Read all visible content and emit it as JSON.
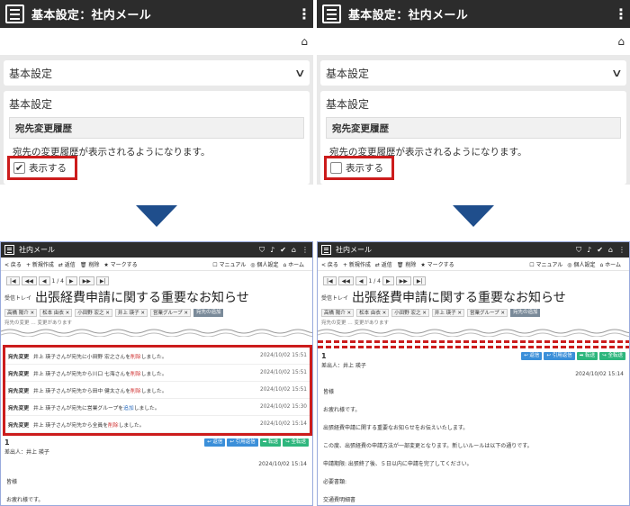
{
  "top": {
    "title": "基本設定：社内メール",
    "accordion_label": "基本設定",
    "panel_title": "基本設定",
    "section_head": "宛先変更履歴",
    "description": "宛先の変更履歴が表示されるようになります。",
    "checkbox_label": "表示する",
    "left_checked": true,
    "right_checked": false
  },
  "arrow_color": "#1f4e8c",
  "highlight_color": "#cc1c1c",
  "mail": {
    "app_title": "社内メール",
    "sub_left": [
      "< 戻る",
      "+ 新規作成",
      "⇄ 返信",
      "🗑 削除",
      "★ マークする"
    ],
    "sub_right": [
      "☐ マニュアル",
      "◎ 個人設定",
      "⌂ ホーム"
    ],
    "pager": "1 / 4",
    "tray": "受信トレイ",
    "subject": "出張経費申請に関する重要なお知らせ",
    "recipients": [
      "高橋 陽介 ✕",
      "松本 由衣 ✕",
      "小田野 宏之 ✕",
      "井上 瑛子 ✕",
      "営業グループ ✕"
    ],
    "history_tag": "宛先の追加",
    "faded_text": "宛先の変更 … 変更があります"
  },
  "history": [
    {
      "kind": "宛先変更",
      "pre": "井上 瑛子さんが宛先に小田野 宏之さんを",
      "act": "削除",
      "post": "しました。",
      "date": "2024/10/02 15:51"
    },
    {
      "kind": "宛先変更",
      "pre": "井上 瑛子さんが宛先から川口 七海さんを",
      "act": "削除",
      "post": "しました。",
      "date": "2024/10/02 15:51"
    },
    {
      "kind": "宛先変更",
      "pre": "井上 瑛子さんが宛先から田中 健太さんを",
      "act": "削除",
      "post": "しました。",
      "date": "2024/10/02 15:51"
    },
    {
      "kind": "宛先変更",
      "pre": "井上 瑛子さんが宛先に営業グループを",
      "act": "追加",
      "post": "しました。",
      "date": "2024/10/02 15:30"
    },
    {
      "kind": "宛先変更",
      "pre": "井上 瑛子さんが宛先から全員を",
      "act": "削除",
      "post": "しました。",
      "date": "2024/10/02 15:14"
    }
  ],
  "message": {
    "number": "1",
    "sender": "差出人：井上 瑛子",
    "buttons": [
      "↩ 返信",
      "↩ 引用返信",
      "➡ 転送",
      "↪ 全転送"
    ],
    "date": "2024/10/02 15:14",
    "body_left": [
      "皆様",
      "お疲れ様です。"
    ],
    "body_right": [
      "皆様",
      "お疲れ様です。",
      "出張経費申請に関する重要なお知らせをお伝えいたします。",
      "この度、出張経費の申請方法が一部変更となります。新しいルールは以下の通りです。",
      "申請期限: 出張終了後、５日以内に申請を完了してください。",
      "必要書類:",
      "交通費明細書"
    ]
  }
}
